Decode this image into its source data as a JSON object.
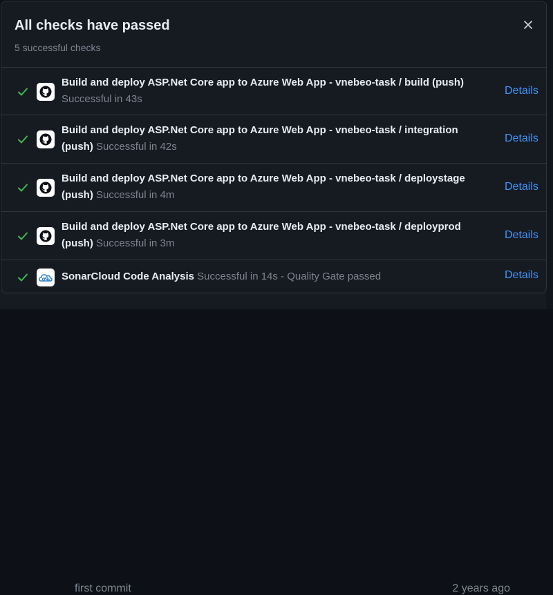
{
  "header": {
    "title": "All checks have passed",
    "subtitle": "5 successful checks",
    "close_icon": "close-icon"
  },
  "checks": [
    {
      "name": "Build and deploy ASP.Net Core app to Azure Web App - vnebeo-task / build (push)",
      "status": "Successful in 43s",
      "details_label": "Details",
      "icon": "github-icon"
    },
    {
      "name": "Build and deploy ASP.Net Core app to Azure Web App - vnebeo-task / integration (push)",
      "status": "Successful in 42s",
      "details_label": "Details",
      "icon": "github-icon"
    },
    {
      "name": "Build and deploy ASP.Net Core app to Azure Web App - vnebeo-task / deploystage (push)",
      "status": "Successful in 4m",
      "details_label": "Details",
      "icon": "github-icon"
    },
    {
      "name": "Build and deploy ASP.Net Core app to Azure Web App - vnebeo-task / deployprod (push)",
      "status": "Successful in 3m",
      "details_label": "Details",
      "icon": "github-icon"
    },
    {
      "name": "SonarCloud Code Analysis",
      "status": "Successful in 14s - Quality Gate passed",
      "details_label": "Details",
      "icon": "sonarcloud-icon"
    }
  ],
  "background": {
    "commit_message": "first commit",
    "commit_time": "2 years ago"
  },
  "colors": {
    "success": "#3fb950",
    "link": "#4493f8",
    "text_primary": "#e6edf3",
    "text_muted": "#7d8590"
  }
}
